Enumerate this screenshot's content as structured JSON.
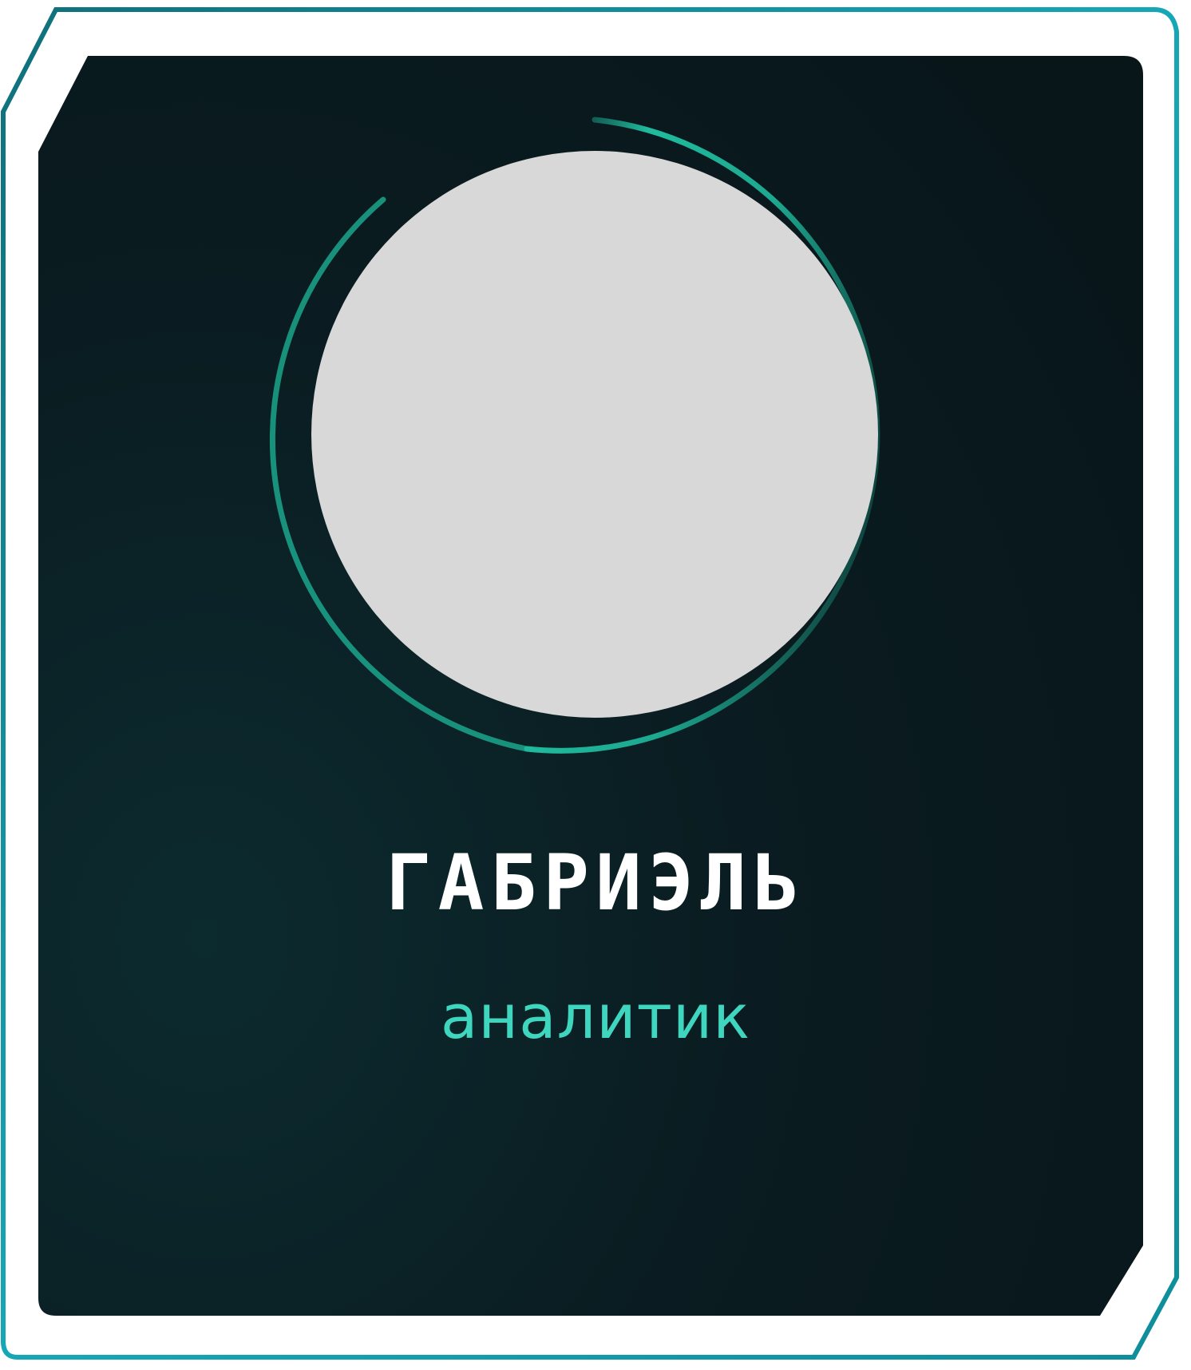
{
  "profile_card": {
    "name": "ГАБРИЭЛЬ",
    "role": "аналитик",
    "avatar_placeholder_color": "#d8d8d8"
  },
  "colors": {
    "card_background": "#0a1a1f",
    "accent": "#23c7a8",
    "frame_edge": "#1aa3b0",
    "name_text": "#ffffff",
    "role_text": "#3fd6c0"
  }
}
